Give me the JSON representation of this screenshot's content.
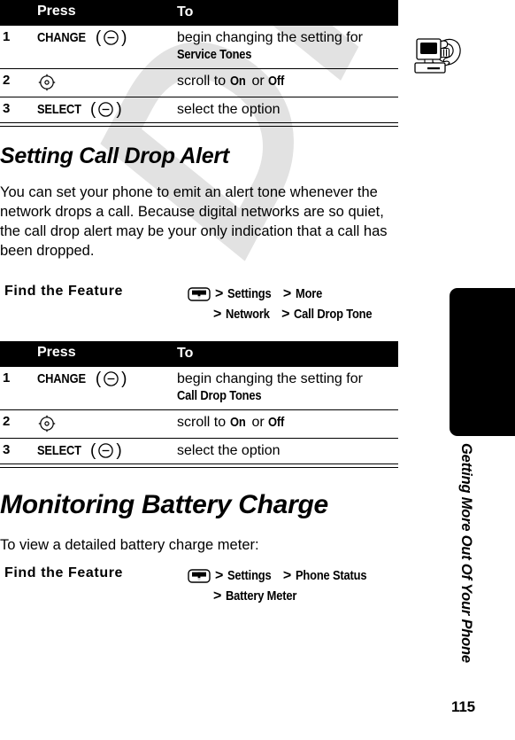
{
  "document": {
    "page_number": "115",
    "chapter_title": "Getting More Out Of Your Phone",
    "watermark": "DRAFT",
    "chapter_tab_icon": "computer-and-telephone-icon"
  },
  "tables": {
    "headers": {
      "step": "",
      "press": "Press",
      "to": "To"
    },
    "service_tones": {
      "rows": [
        {
          "num": "1",
          "press_key": "CHANGE",
          "press_icon": "softkey-icon",
          "to_text": "begin changing the setting for",
          "to_term": "Service Tones"
        },
        {
          "num": "2",
          "press_key": "",
          "press_icon": "navigation-key-icon",
          "to_prefix": "scroll to ",
          "to_term1": "On",
          "to_mid": " or ",
          "to_term2": "Off"
        },
        {
          "num": "3",
          "press_key": "SELECT",
          "press_icon": "softkey-icon",
          "to_text": "select the option"
        }
      ]
    },
    "call_drop_tones": {
      "rows": [
        {
          "num": "1",
          "press_key": "CHANGE",
          "press_icon": "softkey-icon",
          "to_text": "begin changing the setting for",
          "to_term": "Call Drop Tones"
        },
        {
          "num": "2",
          "press_key": "",
          "press_icon": "navigation-key-icon",
          "to_prefix": "scroll to ",
          "to_term1": "On",
          "to_mid": " or ",
          "to_term2": "Off"
        },
        {
          "num": "3",
          "press_key": "SELECT",
          "press_icon": "softkey-icon",
          "to_text": "select the option"
        }
      ]
    }
  },
  "sections": [
    {
      "heading": "Setting Call Drop Alert",
      "body": "You can set your phone to emit an alert tone whenever the network drops a call. Because digital networks are so quiet, the call drop alert may be your only indication that a call has been dropped.",
      "find_feature": {
        "label": "Find the Feature",
        "menu_icon": "menu-key-icon",
        "line1": [
          "Settings",
          "More"
        ],
        "line2": [
          "Network",
          "Call Drop Tone"
        ],
        "separator": ">"
      }
    },
    {
      "heading": "Monitoring Battery Charge",
      "body": "To view a detailed battery charge meter:",
      "find_feature": {
        "label": "Find the Feature",
        "menu_icon": "menu-key-icon",
        "line1": [
          "Settings",
          "Phone Status"
        ],
        "line2": [
          "Battery Meter"
        ],
        "separator": ">"
      }
    }
  ]
}
